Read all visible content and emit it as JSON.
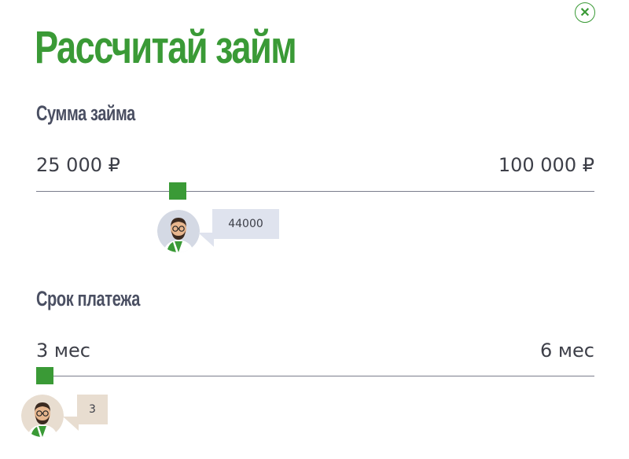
{
  "title": "Рассчитай займ",
  "close_icon": "close-icon",
  "amount": {
    "label": "Сумма займа",
    "min_label": "25 000 ₽",
    "max_label": "100 000 ₽",
    "min": 25000,
    "max": 100000,
    "value": 44000,
    "value_label": "44000",
    "bubble_color": "#dfe3ee"
  },
  "term": {
    "label": "Срок платежа",
    "min_label": "3 мес",
    "max_label": "6 мес",
    "min": 3,
    "max": 6,
    "value": 3,
    "value_label": "3",
    "bubble_color": "#e8ddd0"
  },
  "colors": {
    "accent": "#3a9a36",
    "heading": "#4a4f62",
    "track": "#7a7d8c"
  }
}
